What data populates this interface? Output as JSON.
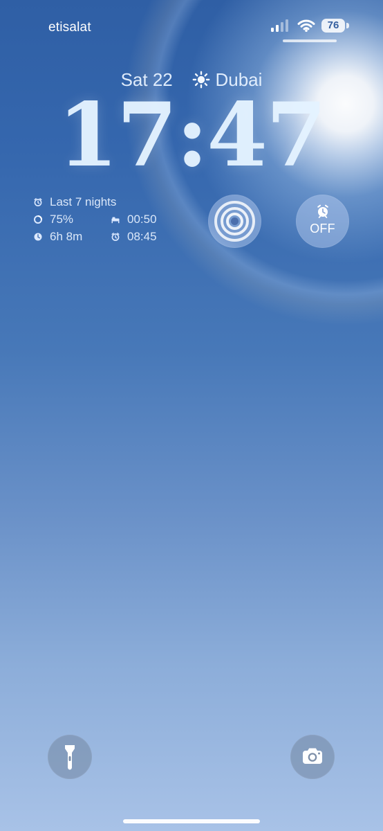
{
  "status_bar": {
    "carrier": "etisalat",
    "battery": "76",
    "icons": [
      "cellular-signal-icon",
      "wifi-icon",
      "battery-icon"
    ]
  },
  "lock_screen": {
    "date": "Sat 22",
    "city": "Dubai",
    "time": "17:47",
    "weather_icon": "sun-icon"
  },
  "sleep_widget": {
    "title": "Last 7 nights",
    "quality": "75%",
    "bedtime": "00:50",
    "duration": "6h 8m",
    "wake_time": "08:45",
    "icons": [
      "alarm-icon",
      "ring-icon",
      "bed-icon",
      "clock-icon"
    ]
  },
  "alarm_widget": {
    "status": "OFF",
    "icon": "alarm-icon"
  },
  "bottom_actions": {
    "left": "flashlight-icon",
    "right": "camera-icon"
  },
  "colors": {
    "sky_top": "#2f5fa5",
    "sky_bottom": "#a8c2e7",
    "widget_fill": "#b7cdf0",
    "text_light": "#e8f2ff"
  }
}
